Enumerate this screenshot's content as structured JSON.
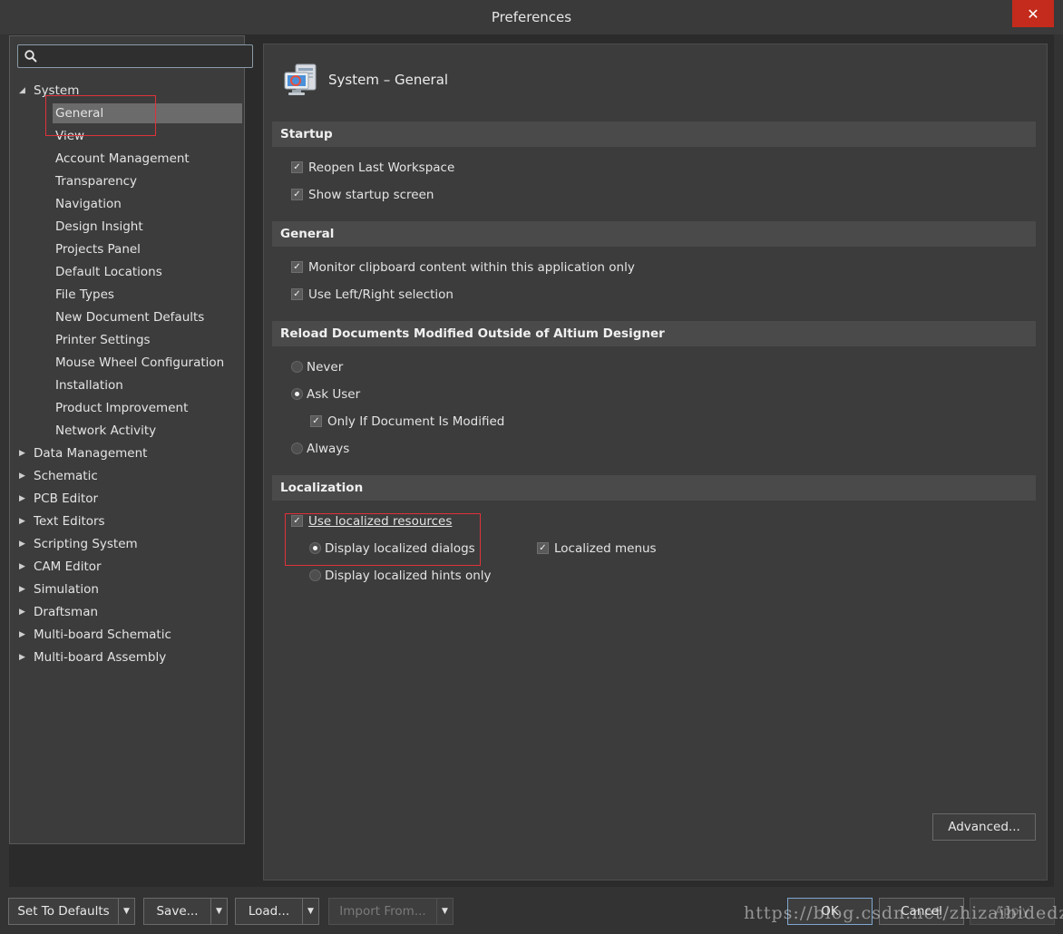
{
  "window": {
    "title": "Preferences",
    "close_glyph": "✕"
  },
  "search": {
    "placeholder": ""
  },
  "tree": {
    "system": "System",
    "system_children": [
      "General",
      "View",
      "Account Management",
      "Transparency",
      "Navigation",
      "Design Insight",
      "Projects Panel",
      "Default Locations",
      "File Types",
      "New Document Defaults",
      "Printer Settings",
      "Mouse Wheel Configuration",
      "Installation",
      "Product Improvement",
      "Network Activity"
    ],
    "roots": [
      "Data Management",
      "Schematic",
      "PCB Editor",
      "Text Editors",
      "Scripting System",
      "CAM Editor",
      "Simulation",
      "Draftsman",
      "Multi-board Schematic",
      "Multi-board Assembly"
    ]
  },
  "page": {
    "title": "System – General",
    "icon": "system-general-icon",
    "sections": {
      "startup": {
        "header": "Startup",
        "reopen_last_workspace": {
          "label": "Reopen Last Workspace",
          "checked": true
        },
        "show_startup_screen": {
          "label": "Show startup screen",
          "checked": true
        }
      },
      "general": {
        "header": "General",
        "monitor_clipboard": {
          "label": "Monitor clipboard content within this application only",
          "checked": true
        },
        "left_right_selection": {
          "label": "Use Left/Right selection",
          "checked": true
        }
      },
      "reload": {
        "header": "Reload Documents Modified Outside of Altium Designer",
        "never": {
          "label": "Never",
          "selected": false
        },
        "ask_user": {
          "label": "Ask User",
          "selected": true
        },
        "only_if_modified": {
          "label": "Only If Document Is Modified",
          "checked": true
        },
        "always": {
          "label": "Always",
          "selected": false
        }
      },
      "localization": {
        "header": "Localization",
        "use_localized": {
          "label": "Use localized resources",
          "checked": true
        },
        "display_dialogs": {
          "label": "Display localized dialogs",
          "selected": true
        },
        "localized_menus": {
          "label": "Localized menus",
          "checked": true
        },
        "display_hints": {
          "label": "Display localized hints only",
          "selected": false
        }
      }
    },
    "advanced_label": "Advanced..."
  },
  "footer": {
    "set_to_defaults": "Set To Defaults",
    "save": "Save...",
    "load": "Load...",
    "import_from": "Import From...",
    "ok": "OK",
    "cancel": "Cancel",
    "apply": "Apply"
  },
  "watermark": "https://blog.csdn.net/zhizaibidedz",
  "colors": {
    "accent_selection": "#6b6b6b",
    "highlight_frame": "#e0323a",
    "close_button": "#c42b1c"
  }
}
